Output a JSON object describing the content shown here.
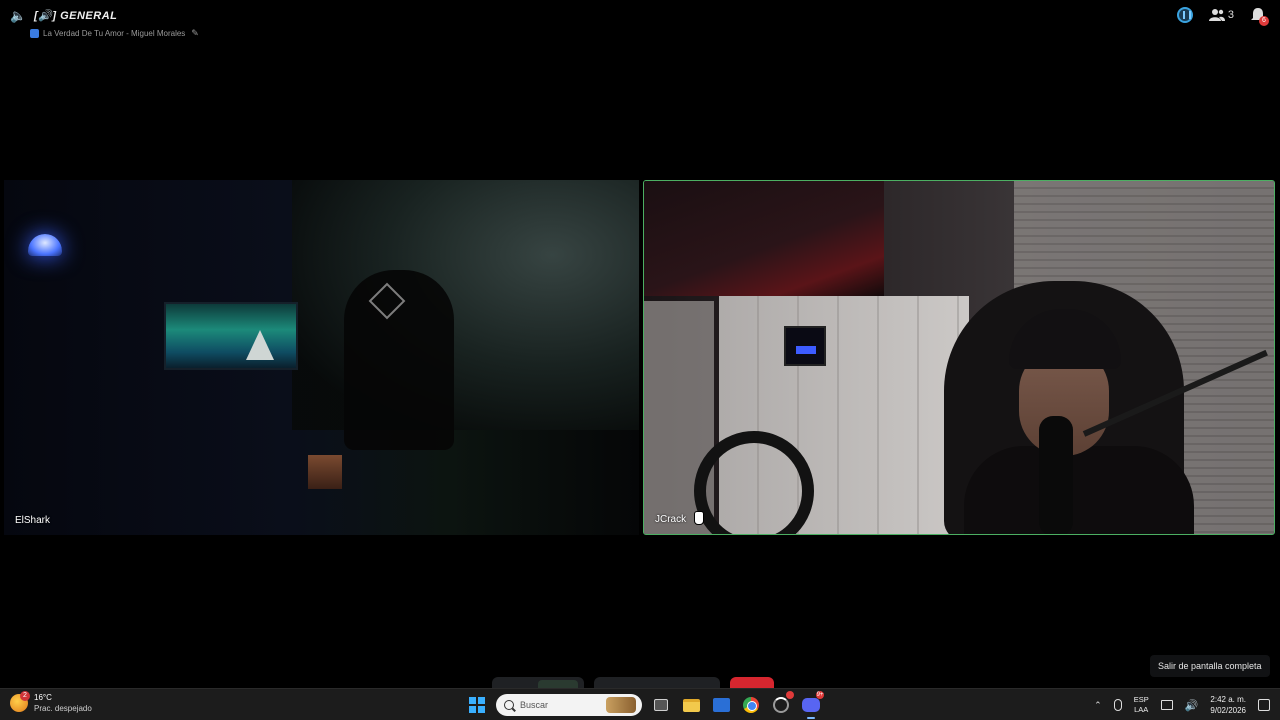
{
  "header": {
    "channel_icon": "speaker-icon",
    "channel_name": "[🔊] GENERAL",
    "status_text": "La Verdad De Tu Amor - Miguel Morales",
    "participants_count": "3"
  },
  "tiles": [
    {
      "name": "ElShark",
      "speaking": false
    },
    {
      "name": "JCrack",
      "speaking": true
    }
  ],
  "colors": {
    "speaking_border": "#4caf62",
    "leave_button": "#d6262f",
    "taskbar_bg": "#1c1c1c"
  },
  "tooltip": {
    "exit_fullscreen": "Salir de pantalla completa"
  },
  "taskbar": {
    "weather_temp": "16°C",
    "weather_desc": "Prac. despejado",
    "weather_badge": "2",
    "search_placeholder": "Buscar",
    "discord_badge": "9+",
    "lang_top": "ESP",
    "lang_bottom": "LAA",
    "time": "2:42 a. m.",
    "date": "9/02/2026"
  }
}
